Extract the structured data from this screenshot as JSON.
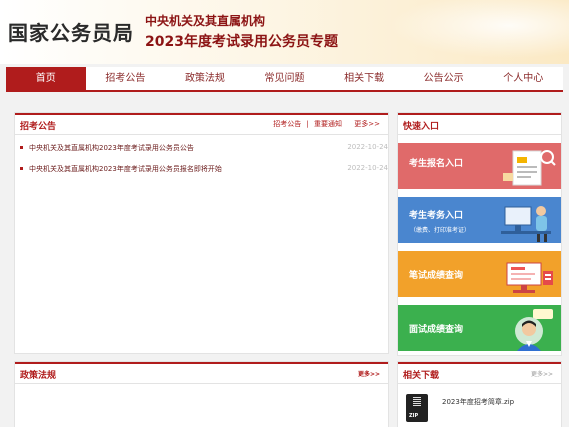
{
  "header": {
    "site_title": "国家公务员局",
    "sub_title_1": "中央机关及其直属机构",
    "sub_title_2": "2023年度考试录用公务员专题"
  },
  "nav": {
    "items": [
      "首页",
      "招考公告",
      "政策法规",
      "常见问题",
      "相关下载",
      "公告公示",
      "个人中心"
    ],
    "active_index": 0
  },
  "announcements": {
    "title": "招考公告",
    "links": [
      "招考公告",
      "|",
      "重要通知"
    ],
    "more": "更多>>",
    "items": [
      {
        "title": "中央机关及其直属机构2023年度考试录用公务员公告",
        "date": "2022-10-24"
      },
      {
        "title": "中央机关及其直属机构2023年度考试录用公务员报名即将开始",
        "date": "2022-10-24"
      }
    ]
  },
  "policy": {
    "title": "政策法规",
    "more": "更多>>"
  },
  "quick_entry": {
    "title": "快速入口",
    "items": [
      {
        "label": "考生报名入口",
        "sub": "",
        "color": "#e06a6a",
        "icon": "registration-form-icon"
      },
      {
        "label": "考生考务入口",
        "sub": "（缴费、打印准考证）",
        "color": "#4a86cf",
        "icon": "computer-desk-icon"
      },
      {
        "label": "笔试成绩查询",
        "sub": "",
        "color": "#f2a12a",
        "icon": "monitor-document-icon"
      },
      {
        "label": "面试成绩查询",
        "sub": "",
        "color": "#3bb04e",
        "icon": "interview-person-icon"
      }
    ]
  },
  "downloads": {
    "title": "相关下载",
    "more": "更多>>",
    "items": [
      {
        "name": "2023年度招考简章.zip",
        "icon": "zip-file-icon"
      }
    ]
  },
  "colors": {
    "brand_red": "#b01c1c"
  }
}
